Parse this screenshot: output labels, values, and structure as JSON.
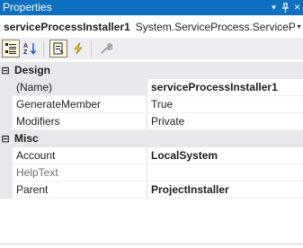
{
  "window": {
    "title": "Properties",
    "pin_glyph": "▾",
    "autohide_glyph": "⊥",
    "close_glyph": "✕"
  },
  "object_selector": {
    "name": "serviceProcessInstaller1",
    "type": "System.ServiceProcess.ServiceProce",
    "dropdown_glyph": "▾"
  },
  "toolbar": {
    "buttons": [
      {
        "icon": "categorized-icon",
        "active": true
      },
      {
        "icon": "alphabetical-icon",
        "active": false
      },
      {
        "icon": "properties-icon",
        "active": true
      },
      {
        "icon": "events-icon",
        "active": false
      },
      {
        "icon": "property-pages-icon",
        "active": false
      }
    ]
  },
  "grid": {
    "categories": [
      {
        "name": "Design",
        "toggle": "⊟",
        "properties": [
          {
            "name": "(Name)",
            "value": "serviceProcessInstaller1",
            "bold": true
          },
          {
            "name": "GenerateMember",
            "value": "True",
            "bold": false
          },
          {
            "name": "Modifiers",
            "value": "Private",
            "bold": false
          }
        ]
      },
      {
        "name": "Misc",
        "toggle": "⊟",
        "properties": [
          {
            "name": "Account",
            "value": "LocalSystem",
            "bold": true
          },
          {
            "name": "HelpText",
            "value": "",
            "bold": false,
            "dimmed": true
          },
          {
            "name": "Parent",
            "value": "ProjectInstaller",
            "bold": true
          }
        ]
      }
    ]
  },
  "colors": {
    "titlebar": "#0e70c0",
    "category_bg": "#e8e8ec",
    "toolbar_bg": "#eeeef2",
    "events_icon": "#f3c318"
  }
}
